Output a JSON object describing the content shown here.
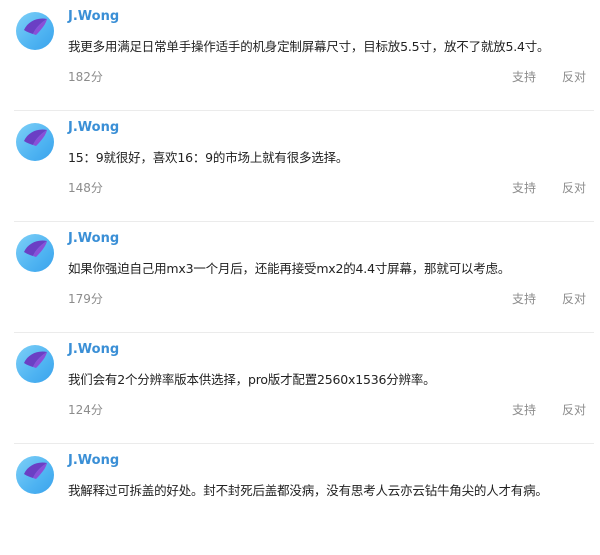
{
  "comments": [
    {
      "user": "J.Wong",
      "text": "我更多用满足日常单手操作适手的机身定制屏幕尺寸，目标放5.5寸，放不了就放5.4寸。",
      "score": "182分",
      "support_label": "支持",
      "oppose_label": "反对"
    },
    {
      "user": "J.Wong",
      "text": "15：9就很好，喜欢16：9的市场上就有很多选择。",
      "score": "148分",
      "support_label": "支持",
      "oppose_label": "反对"
    },
    {
      "user": "J.Wong",
      "text": "如果你强迫自己用mx3一个月后，还能再接受mx2的4.4寸屏幕，那就可以考虑。",
      "score": "179分",
      "support_label": "支持",
      "oppose_label": "反对"
    },
    {
      "user": "J.Wong",
      "text": "我们会有2个分辨率版本供选择，pro版才配置2560x1536分辨率。",
      "score": "124分",
      "support_label": "支持",
      "oppose_label": "反对"
    },
    {
      "user": "J.Wong",
      "text": "我解释过可拆盖的好处。封不封死后盖都没病，没有思考人云亦云钻牛角尖的人才有病。",
      "score": "",
      "support_label": "",
      "oppose_label": ""
    }
  ],
  "colors": {
    "username": "#3a8fd6",
    "text": "#222222",
    "meta": "#8c8c8c",
    "divider": "#ebebeb",
    "avatar_blue": "#4fb4f2",
    "avatar_purple": "#6b3fc4"
  },
  "icons": {
    "avatar": "avatar-icon"
  }
}
